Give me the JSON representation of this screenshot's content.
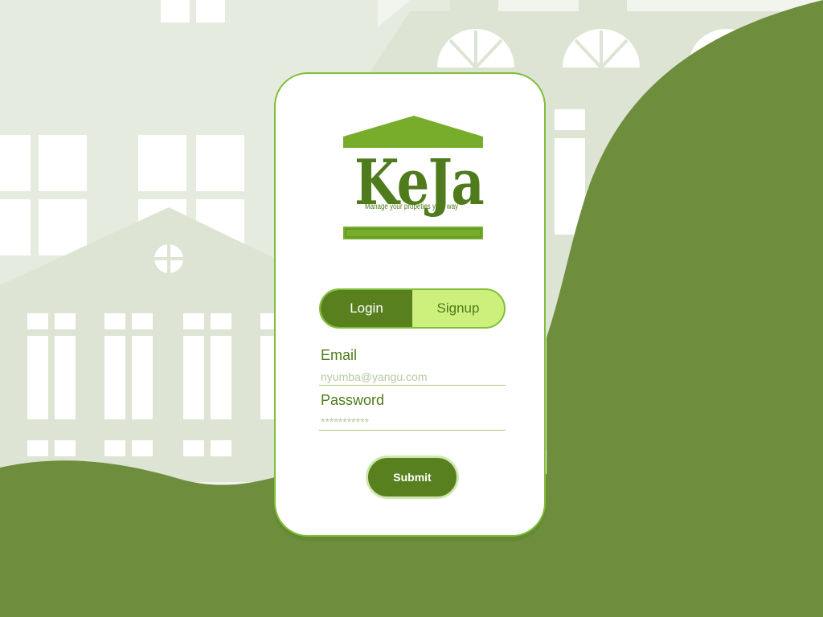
{
  "brand": {
    "name": "KeJa",
    "tagline": "Manage your propeties your way"
  },
  "auth_toggle": {
    "login_label": "Login",
    "signup_label": "Signup",
    "selected": "Login"
  },
  "form": {
    "email_label": "Email",
    "email_placeholder": "nyumba@yangu.com",
    "password_label": "Password",
    "password_placeholder": "***********",
    "submit_label": "Submit"
  },
  "colors": {
    "accent_dark": "#58801e",
    "accent_light": "#cdf07c",
    "background_wave": "#6e8e3e",
    "buildings": "#dde4d3"
  }
}
